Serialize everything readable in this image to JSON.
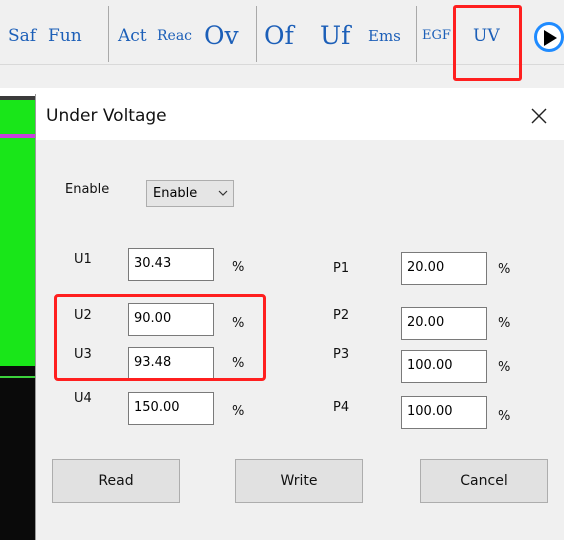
{
  "toolbar": {
    "buttons": [
      {
        "label": "Saf"
      },
      {
        "label": "Fun"
      },
      {
        "label": "Act"
      },
      {
        "label": "Reac"
      },
      {
        "label": "Ov"
      },
      {
        "label": "Of"
      },
      {
        "label": "Uf"
      },
      {
        "label": "Ems"
      },
      {
        "label": "EGF"
      },
      {
        "label": "UV"
      }
    ],
    "play_icon": "play-icon",
    "highlight_color": "#ff1f1f"
  },
  "dialog": {
    "title": "Under Voltage",
    "close_icon": "close-icon",
    "enable_label": "Enable",
    "enable_value": "Enable",
    "u_params": [
      {
        "label": "U1",
        "value": "30.43",
        "unit": "%"
      },
      {
        "label": "U2",
        "value": "90.00",
        "unit": "%"
      },
      {
        "label": "U3",
        "value": "93.48",
        "unit": "%"
      },
      {
        "label": "U4",
        "value": "150.00",
        "unit": "%"
      }
    ],
    "p_params": [
      {
        "label": "P1",
        "value": "20.00",
        "unit": "%"
      },
      {
        "label": "P2",
        "value": "20.00",
        "unit": "%"
      },
      {
        "label": "P3",
        "value": "100.00",
        "unit": "%"
      },
      {
        "label": "P4",
        "value": "100.00",
        "unit": "%"
      }
    ],
    "read_label": "Read",
    "write_label": "Write",
    "cancel_label": "Cancel"
  }
}
